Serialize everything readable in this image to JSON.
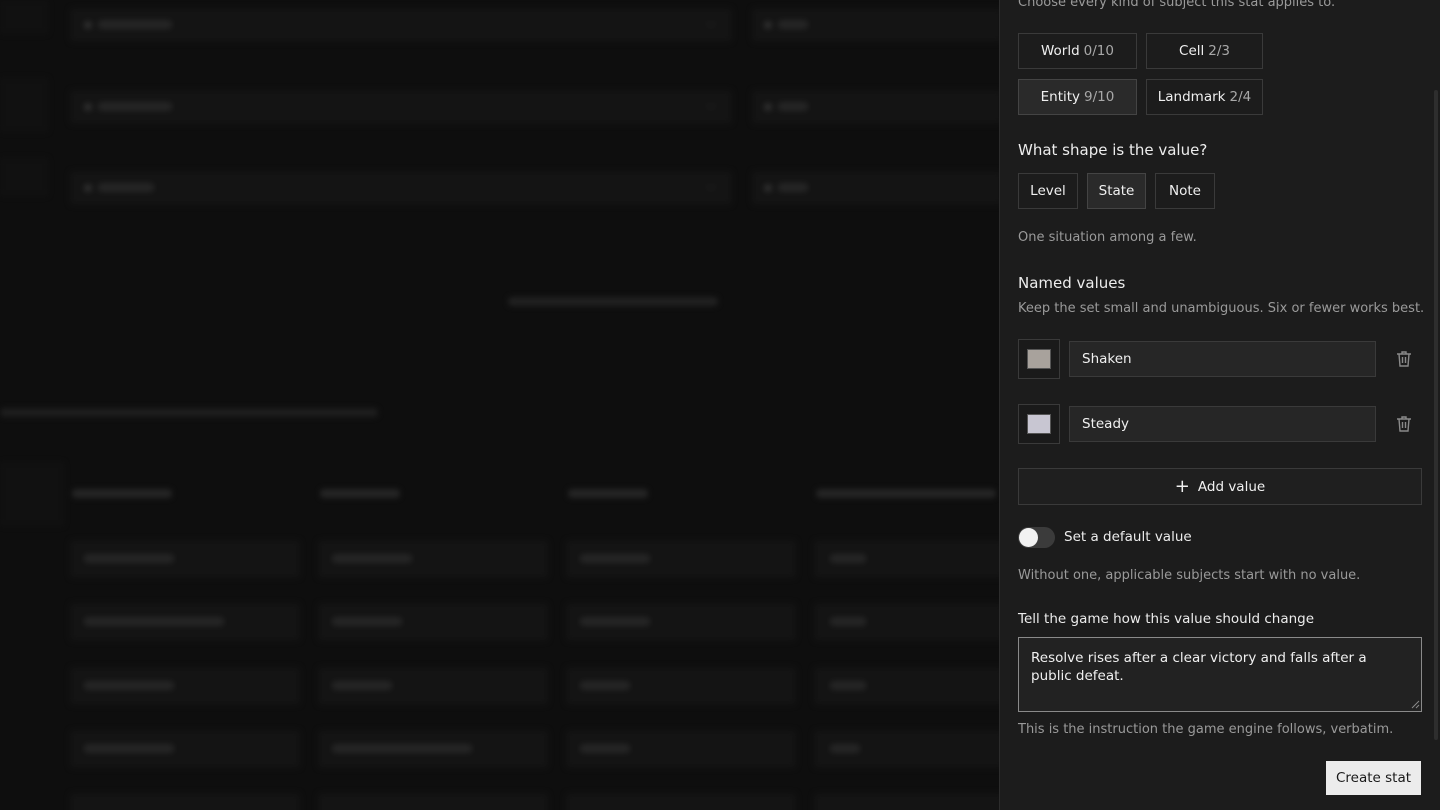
{
  "panel": {
    "subjects_hint": "Choose every kind of subject this stat applies to.",
    "subjects": [
      {
        "label": "World",
        "count": "0/10",
        "selected": false
      },
      {
        "label": "Cell",
        "count": "2/3",
        "selected": false
      },
      {
        "label": "Entity",
        "count": "9/10",
        "selected": true
      },
      {
        "label": "Landmark",
        "count": "2/4",
        "selected": false
      }
    ],
    "shape_heading": "What shape is the value?",
    "shapes": [
      {
        "label": "Level",
        "selected": false
      },
      {
        "label": "State",
        "selected": true
      },
      {
        "label": "Note",
        "selected": false
      }
    ],
    "shape_desc": "One situation among a few.",
    "named_values_heading": "Named values",
    "named_values_hint": "Keep the set small and unambiguous. Six or fewer works best.",
    "named_values": [
      {
        "value": "Shaken",
        "color": "#a8a29c"
      },
      {
        "value": "Steady",
        "color": "#c8c6d2"
      }
    ],
    "add_value_label": "Add value",
    "default_toggle_label": "Set a default value",
    "default_toggle_on": false,
    "default_hint": "Without one, applicable subjects start with no value.",
    "change_label": "Tell the game how this value should change",
    "change_text": "Resolve rises after a clear victory and falls after a public defeat.",
    "change_hint": "This is the instruction the game engine follows, verbatim.",
    "create_label": "Create stat"
  },
  "colors": {
    "panel_bg": "#1c1c1c",
    "page_bg": "#141414",
    "primary_button": "#ececec"
  }
}
